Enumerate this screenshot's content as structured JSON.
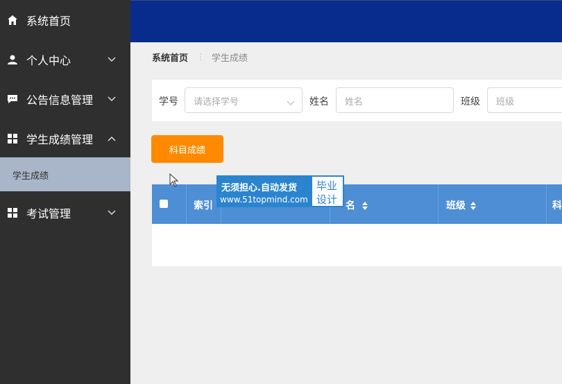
{
  "sidebar": {
    "items": [
      {
        "label": "系统首页",
        "icon": "home-icon"
      },
      {
        "label": "个人中心",
        "icon": "user-icon",
        "expanded": false
      },
      {
        "label": "公告信息管理",
        "icon": "message-icon",
        "expanded": false
      },
      {
        "label": "学生成绩管理",
        "icon": "grid-icon",
        "expanded": true
      },
      {
        "label": "考试管理",
        "icon": "grid-icon",
        "expanded": false
      }
    ],
    "subitem": {
      "label": "学生成绩"
    }
  },
  "breadcrumb": {
    "home": "系统首页",
    "current": "学生成绩"
  },
  "search": {
    "student_no": {
      "label": "学号",
      "placeholder": "请选择学号"
    },
    "name": {
      "label": "姓名",
      "placeholder": "姓名"
    },
    "class": {
      "label": "班级",
      "placeholder": "班级"
    }
  },
  "buttons": {
    "subject_score": "科目成绩"
  },
  "table": {
    "headers": [
      "索引",
      "名",
      "班级",
      "科"
    ]
  },
  "watermark": {
    "line1": "无须担心.自动发货",
    "line2": "www.51topmind.com",
    "tag1": "毕业",
    "tag2": "设计"
  },
  "colors": {
    "sidebar_bg": "#2f2f2f",
    "topbar_bg": "#082c8e",
    "accent_button": "#ff8a00",
    "table_header": "#4d8ed4"
  }
}
